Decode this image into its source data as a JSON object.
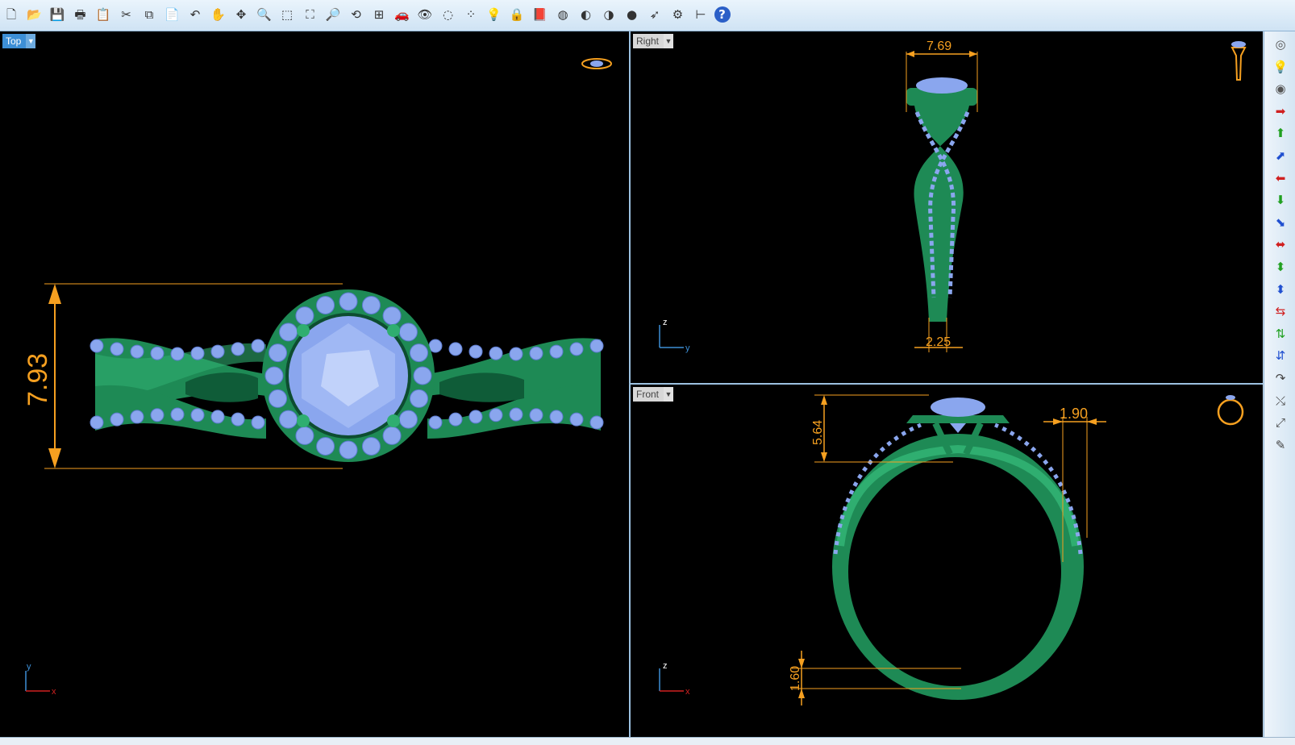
{
  "toolbar": {
    "buttons": [
      {
        "name": "new-file",
        "glyph": "🗋"
      },
      {
        "name": "open-folder",
        "glyph": "📂"
      },
      {
        "name": "save",
        "glyph": "💾"
      },
      {
        "name": "print",
        "glyph": "🖶"
      },
      {
        "name": "properties",
        "glyph": "📋"
      },
      {
        "name": "cut",
        "glyph": "✂"
      },
      {
        "name": "copy",
        "glyph": "⧉"
      },
      {
        "name": "paste",
        "glyph": "📄"
      },
      {
        "name": "undo",
        "glyph": "↶"
      },
      {
        "name": "pan",
        "glyph": "✋"
      },
      {
        "name": "rotate-view",
        "glyph": "✥"
      },
      {
        "name": "zoom",
        "glyph": "🔍"
      },
      {
        "name": "zoom-window",
        "glyph": "⬚"
      },
      {
        "name": "zoom-extents",
        "glyph": "⛶"
      },
      {
        "name": "zoom-selected",
        "glyph": "🔎"
      },
      {
        "name": "undo-view",
        "glyph": "⟲"
      },
      {
        "name": "four-viewports",
        "glyph": "⊞"
      },
      {
        "name": "car",
        "glyph": "🚗"
      },
      {
        "name": "hide",
        "glyph": "👁"
      },
      {
        "name": "show",
        "glyph": "◌"
      },
      {
        "name": "points",
        "glyph": "⁘"
      },
      {
        "name": "light",
        "glyph": "💡"
      },
      {
        "name": "lock",
        "glyph": "🔒"
      },
      {
        "name": "layer",
        "glyph": "📕"
      },
      {
        "name": "color",
        "glyph": "◍"
      },
      {
        "name": "shaded",
        "glyph": "◐"
      },
      {
        "name": "rendered",
        "glyph": "◑"
      },
      {
        "name": "render-sphere",
        "glyph": "●"
      },
      {
        "name": "pointer",
        "glyph": "➶"
      },
      {
        "name": "settings",
        "glyph": "⚙"
      },
      {
        "name": "dimension",
        "glyph": "⊢"
      },
      {
        "name": "help",
        "glyph": "?"
      }
    ]
  },
  "viewports": {
    "top": {
      "label": "Top"
    },
    "right": {
      "label": "Right"
    },
    "front": {
      "label": "Front"
    }
  },
  "dimensions": {
    "top_height": "7.93",
    "right_width": "7.69",
    "right_shank": "2.25",
    "front_head": "5.64",
    "front_side": "1.90",
    "front_band": "1.60"
  },
  "axes": {
    "x": "x",
    "y": "y",
    "z": "z"
  },
  "sidebar": {
    "buttons": [
      {
        "name": "environment",
        "glyph": "◎",
        "color": "#555"
      },
      {
        "name": "light",
        "glyph": "💡",
        "color": "#555"
      },
      {
        "name": "material-ball",
        "glyph": "◉",
        "color": "#555"
      },
      {
        "name": "move-right",
        "glyph": "➡",
        "color": "#d02020"
      },
      {
        "name": "move-up",
        "glyph": "⬆",
        "color": "#20a020"
      },
      {
        "name": "move-out",
        "glyph": "⬈",
        "color": "#2050d0"
      },
      {
        "name": "move-left",
        "glyph": "⬅",
        "color": "#d02020"
      },
      {
        "name": "move-down",
        "glyph": "⬇",
        "color": "#20a020"
      },
      {
        "name": "move-in",
        "glyph": "⬊",
        "color": "#2050d0"
      },
      {
        "name": "scale-x",
        "glyph": "⬌",
        "color": "#d02020"
      },
      {
        "name": "scale-y",
        "glyph": "⬍",
        "color": "#20a020"
      },
      {
        "name": "scale-z",
        "glyph": "⬍",
        "color": "#2050d0"
      },
      {
        "name": "shrink-x",
        "glyph": "⇆",
        "color": "#d02020"
      },
      {
        "name": "shrink-y",
        "glyph": "⇅",
        "color": "#20a020"
      },
      {
        "name": "shrink-z",
        "glyph": "⇵",
        "color": "#2050d0"
      },
      {
        "name": "bend",
        "glyph": "↷",
        "color": "#444"
      },
      {
        "name": "twist",
        "glyph": "⤯",
        "color": "#444"
      },
      {
        "name": "flow",
        "glyph": "⤢",
        "color": "#444"
      },
      {
        "name": "eraser",
        "glyph": "✎",
        "color": "#444"
      }
    ]
  },
  "colors": {
    "metal": "#1e8a55",
    "metal_light": "#2fae70",
    "gem": "#8aa6ee",
    "dimension": "#f6a020",
    "viewport_bg": "#000000",
    "active_label": "#3d8fd6"
  }
}
